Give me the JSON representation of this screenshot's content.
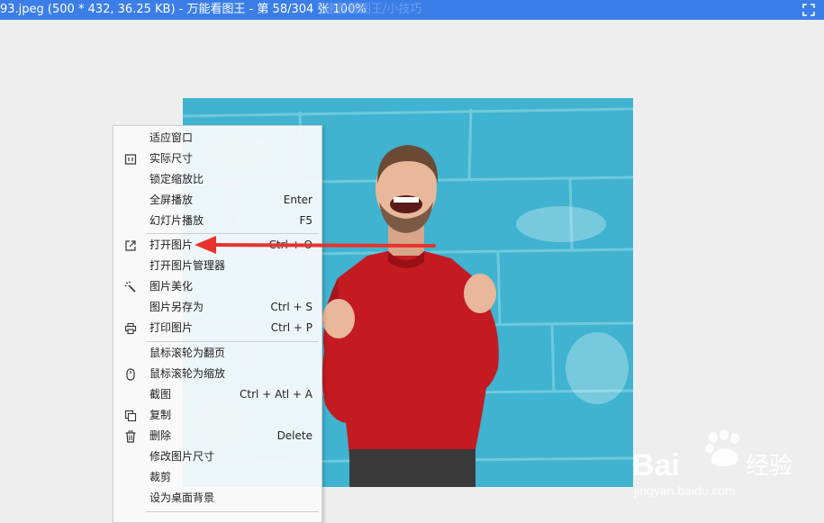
{
  "window": {
    "title": "93.jpeg (500 * 432, 36.25 KB) - 万能看图王 - 第 58/304 张 100%",
    "title_ghost": "速置看图王/小技巧"
  },
  "context_menu": {
    "items": [
      {
        "label": "适应窗口",
        "shortcut": "",
        "icon": ""
      },
      {
        "label": "实际尺寸",
        "shortcut": "",
        "icon": "actual-size-icon"
      },
      {
        "label": "锁定缩放比",
        "shortcut": "",
        "icon": ""
      },
      {
        "label": "全屏播放",
        "shortcut": "Enter",
        "icon": ""
      },
      {
        "label": "幻灯片播放",
        "shortcut": "F5",
        "icon": ""
      },
      {
        "label": "打开图片",
        "shortcut": "Ctrl + O",
        "icon": "open-external-icon"
      },
      {
        "label": "打开图片管理器",
        "shortcut": "",
        "icon": ""
      },
      {
        "label": "图片美化",
        "shortcut": "",
        "icon": "magic-wand-icon"
      },
      {
        "label": "图片另存为",
        "shortcut": "Ctrl + S",
        "icon": ""
      },
      {
        "label": "打印图片",
        "shortcut": "Ctrl + P",
        "icon": "printer-icon"
      },
      {
        "label": "鼠标滚轮为翻页",
        "shortcut": "",
        "icon": ""
      },
      {
        "label": "鼠标滚轮为缩放",
        "shortcut": "",
        "icon": "mouse-icon"
      },
      {
        "label": "截图",
        "shortcut": "Ctrl + Atl + A",
        "icon": ""
      },
      {
        "label": "复制",
        "shortcut": "",
        "icon": "copy-icon"
      },
      {
        "label": "删除",
        "shortcut": "Delete",
        "icon": "trash-icon"
      },
      {
        "label": "修改图片尺寸",
        "shortcut": "",
        "icon": ""
      },
      {
        "label": "裁剪",
        "shortcut": "",
        "icon": ""
      },
      {
        "label": "设为桌面背景",
        "shortcut": "",
        "icon": ""
      }
    ]
  },
  "watermark": {
    "brand_text": "Bai",
    "brand_suffix": "经验",
    "url": "jingyan.baidu.com"
  },
  "colors": {
    "titlebar": "#3b7ee8",
    "annotation_arrow": "#e8322c",
    "wall": "#3fb3cf",
    "sweater": "#c41a22"
  }
}
